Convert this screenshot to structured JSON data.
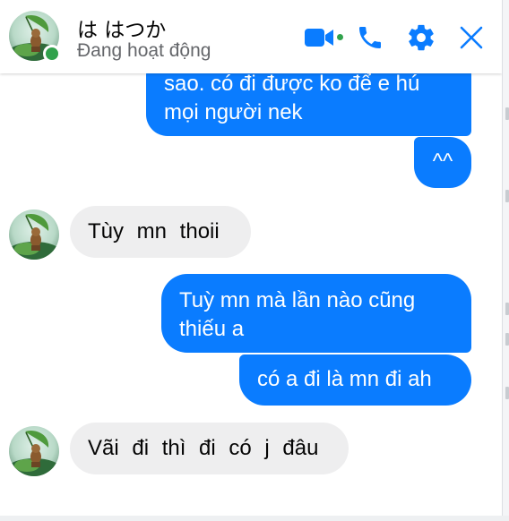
{
  "header": {
    "contact_name": "は はつか",
    "status": "Đang hoạt động",
    "icons": [
      "video-camera-icon",
      "phone-icon",
      "gear-icon",
      "close-icon"
    ],
    "accent_color": "#0a7cff",
    "online_color": "#31a24c"
  },
  "messages": [
    {
      "direction": "outgoing",
      "lines": [
        "sao. có đi được ko để e hú",
        "mọi người nek"
      ]
    },
    {
      "direction": "outgoing",
      "lines": [
        "^^"
      ]
    },
    {
      "direction": "incoming",
      "lines": [
        "Tùy mn thoii"
      ]
    },
    {
      "direction": "outgoing",
      "lines": [
        "Tuỳ mn mà lần nào cũng",
        "thiếu a"
      ]
    },
    {
      "direction": "outgoing",
      "lines": [
        "có a đi là mn đi ah"
      ]
    },
    {
      "direction": "incoming",
      "lines": [
        "Vãi đi thì đi có j đâu"
      ]
    }
  ],
  "colors": {
    "outgoing_bubble": "#0a7cff",
    "incoming_bubble": "#eeeeef"
  }
}
